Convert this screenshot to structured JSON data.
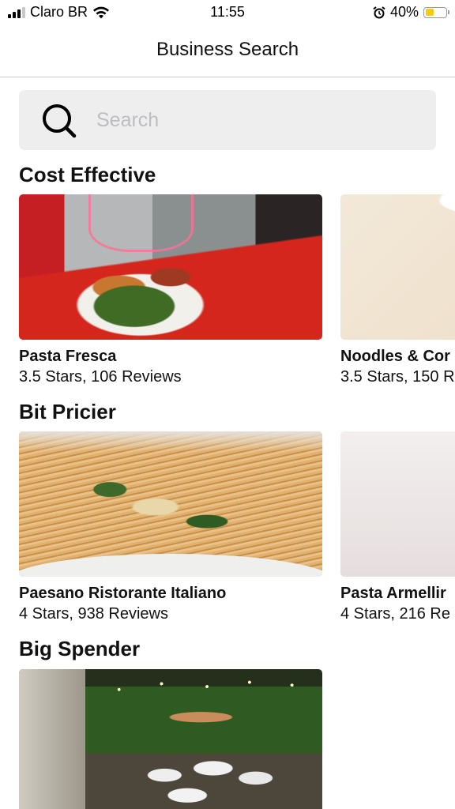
{
  "status_bar": {
    "carrier": "Claro BR",
    "time": "11:55",
    "battery_percent": "40%",
    "battery_level": 0.4,
    "signal_bars_active": 3,
    "signal_bars_total": 4
  },
  "nav": {
    "title": "Business Search"
  },
  "search": {
    "placeholder": "Search",
    "value": ""
  },
  "sections": [
    {
      "title": "Cost Effective",
      "cards": [
        {
          "name": "Pasta Fresca",
          "meta": "3.5 Stars, 106 Reviews"
        },
        {
          "name": "Noodles & Cor",
          "meta": "3.5 Stars, 150 R"
        }
      ]
    },
    {
      "title": "Bit Pricier",
      "cards": [
        {
          "name": "Paesano Ristorante Italiano",
          "meta": "4 Stars, 938 Reviews"
        },
        {
          "name": "Pasta Armellir",
          "meta": "4 Stars, 216 Re"
        }
      ]
    },
    {
      "title": "Big Spender",
      "cards": [
        {
          "name": "",
          "meta": ""
        }
      ]
    }
  ],
  "icons": {
    "search": "search-icon",
    "wifi": "wifi-icon",
    "alarm": "alarm-clock-icon",
    "battery": "battery-icon",
    "signal": "cellular-signal-icon"
  },
  "colors": {
    "search_background": "#eeeeef",
    "placeholder": "#bdbdc2",
    "battery_fill": "#f7cc12",
    "divider": "#c9c9c9"
  }
}
